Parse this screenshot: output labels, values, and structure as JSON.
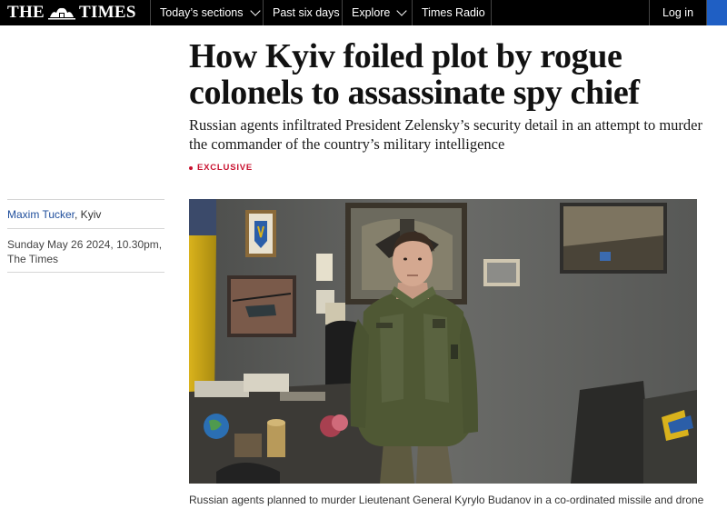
{
  "header": {
    "logo_left": "THE",
    "logo_right": "TIMES",
    "nav": [
      {
        "label": "Today’s sections",
        "dropdown": true
      },
      {
        "label": "Past six days",
        "dropdown": false
      },
      {
        "label": "Explore",
        "dropdown": true
      },
      {
        "label": "Times Radio",
        "dropdown": false
      }
    ],
    "login_label": "Log in"
  },
  "article": {
    "headline": "How Kyiv foiled plot by rogue colonels to assassinate spy chief",
    "standfirst": "Russian agents infiltrated President Zelensky’s security detail in an attempt to murder the commander of the country’s military intelligence",
    "tag": "EXCLUSIVE",
    "author": "Maxim Tucker",
    "location": ", Kyiv",
    "date": "Sunday May 26 2024, 10.30pm,",
    "publication": "The Times",
    "caption": "Russian agents planned to murder Lieutenant General Kyrylo Budanov in a co-ordinated missile and drone"
  },
  "colors": {
    "topbar": "#000000",
    "accent_blue": "#1f5fc4",
    "tag_red": "#c8102e",
    "author_link": "#1f4e9c"
  },
  "icons": [
    "crest-logo-icon",
    "chevron-down-icon",
    "account-icon"
  ]
}
